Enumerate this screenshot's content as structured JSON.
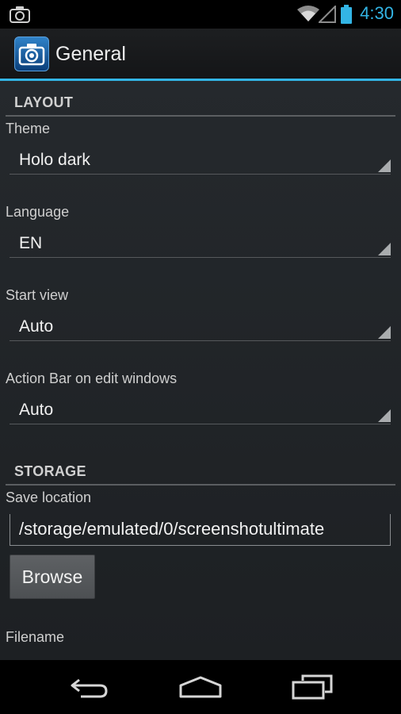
{
  "status_bar": {
    "time": "4:30",
    "accent_color": "#33b5e5",
    "icons": [
      "camera-icon",
      "wifi-icon",
      "signal-icon",
      "battery-icon"
    ]
  },
  "action_bar": {
    "title": "General",
    "app_icon": "camera-app-icon"
  },
  "layout_section": {
    "header": "LAYOUT",
    "prefs": [
      {
        "label": "Theme",
        "value": "Holo dark"
      },
      {
        "label": "Language",
        "value": "EN"
      },
      {
        "label": "Start view",
        "value": "Auto"
      },
      {
        "label": "Action Bar on edit windows",
        "value": "Auto"
      }
    ]
  },
  "storage_section": {
    "header": "STORAGE",
    "save_location_label": "Save location",
    "save_location_value": "/storage/emulated/0/screenshotultimate",
    "browse_label": "Browse",
    "filename_label": "Filename"
  },
  "nav_bar": {
    "icons": [
      "back-icon",
      "home-icon",
      "recent-apps-icon"
    ]
  }
}
